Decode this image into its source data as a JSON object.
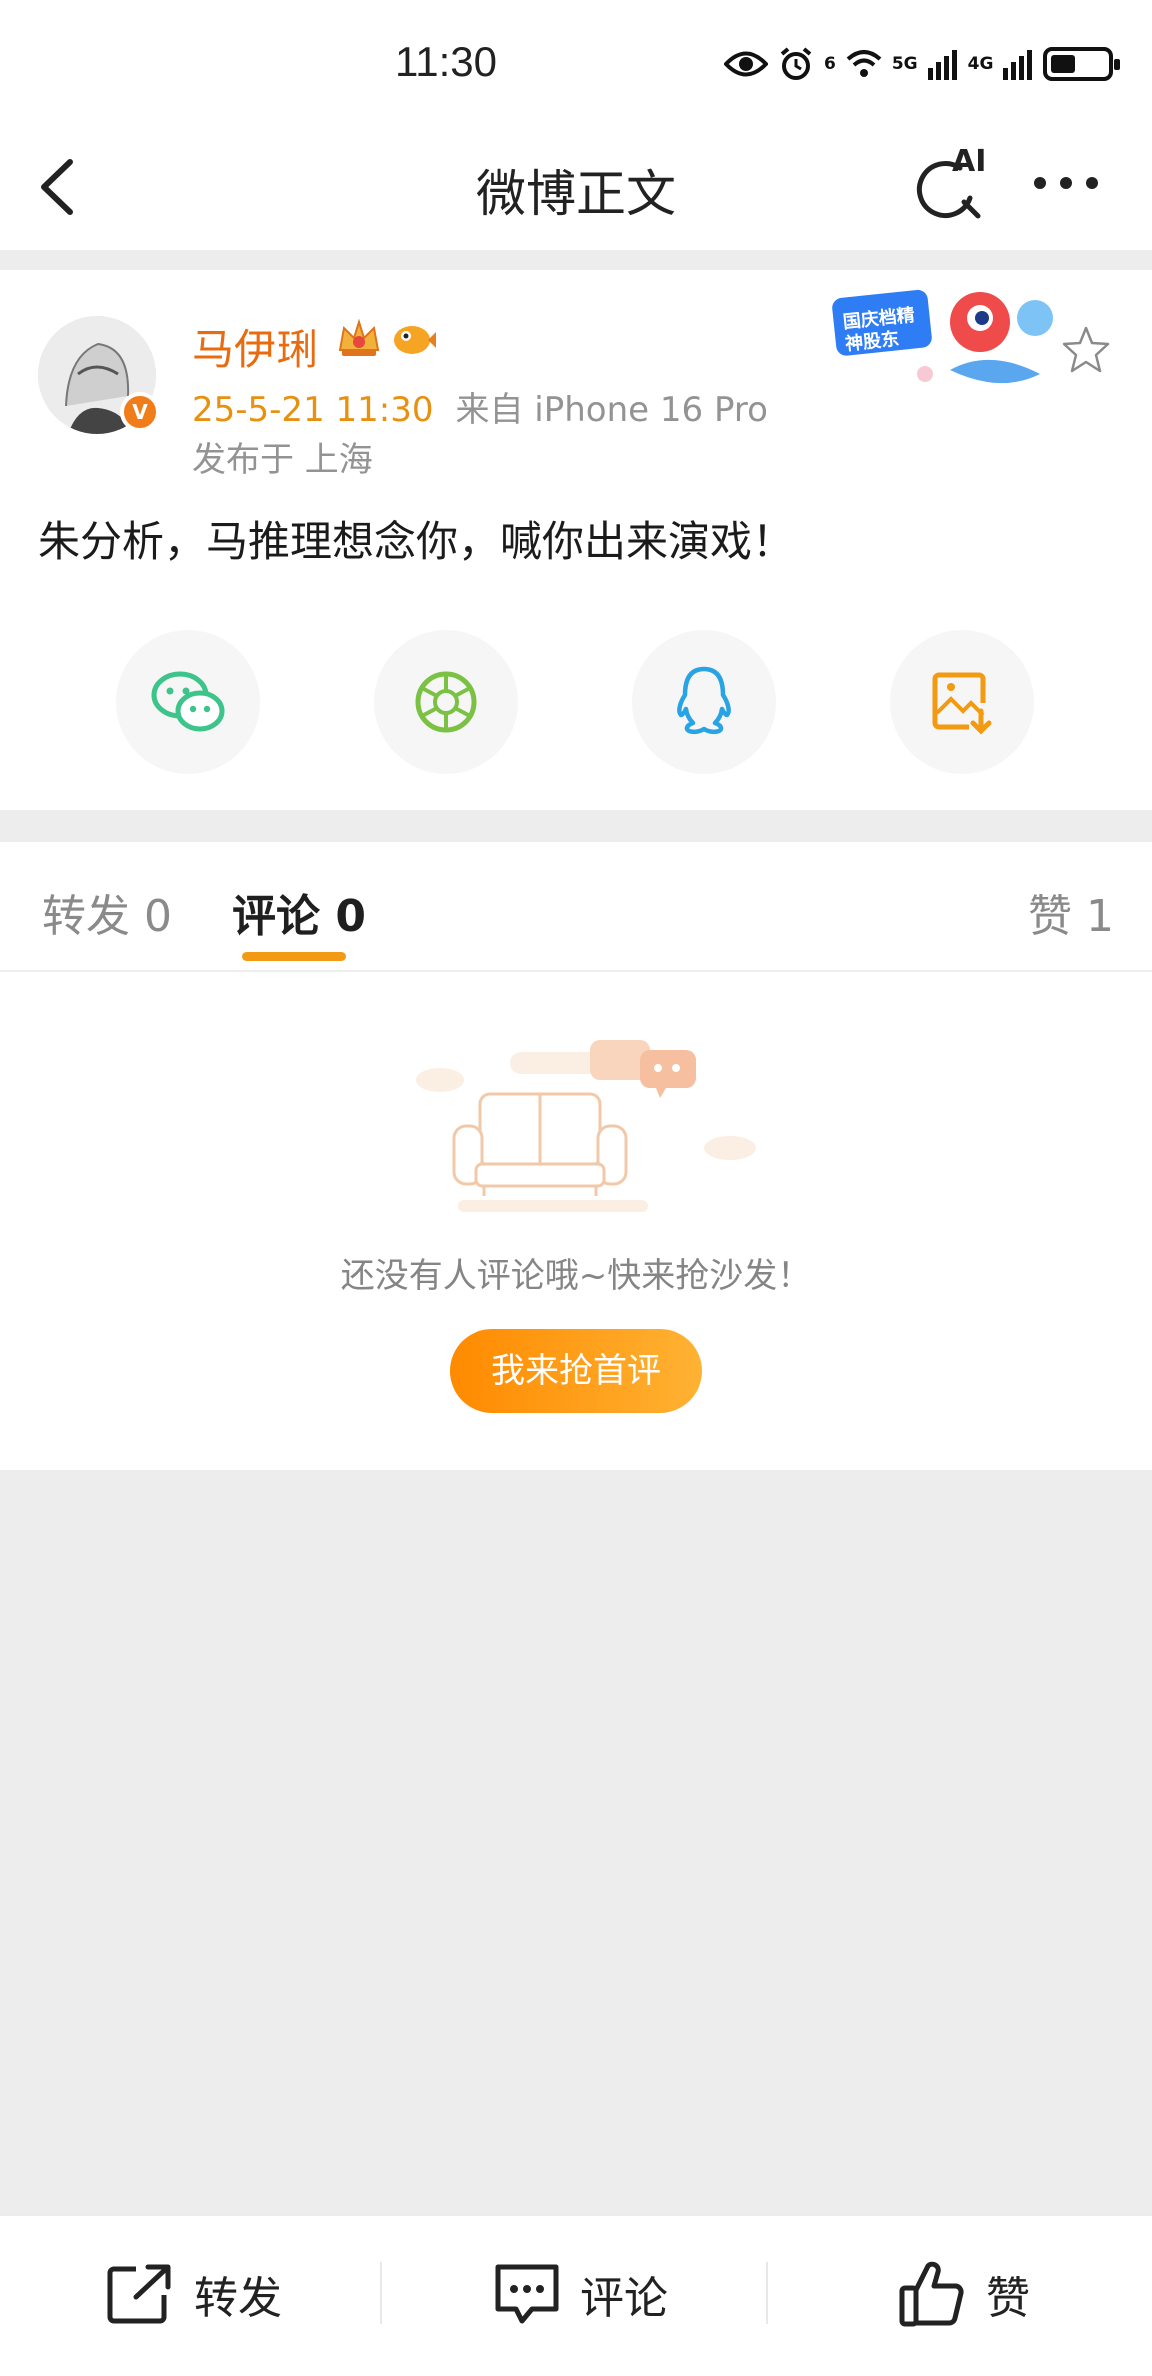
{
  "status_bar": {
    "time": "11:30",
    "sim1_label": "5G",
    "sim2_label": "4G",
    "wifi_label": "6"
  },
  "nav": {
    "title": "微博正文",
    "ai_label": "AI"
  },
  "post": {
    "username": "马伊琍",
    "date": "25-5-21 11:30",
    "source": "来自 iPhone 16 Pro",
    "location": "发布于 上海",
    "text": "朱分析，马推理想念你，喊你出来演戏！",
    "verified_mark": "V",
    "promo_text": "国庆档精神股东",
    "share_icons": [
      "wechat-icon",
      "moments-icon",
      "qq-icon",
      "save-image-icon"
    ]
  },
  "tabs": {
    "repost": "转发 0",
    "comment": "评论 0",
    "like": "赞 1"
  },
  "empty_state": {
    "message": "还没有人评论哦~快来抢沙发！",
    "cta": "我来抢首评"
  },
  "bottom_bar": {
    "repost": "转发",
    "comment": "评论",
    "like": "赞"
  },
  "colors": {
    "accent": "#f39a15",
    "username": "#e86b0f",
    "date": "#e8900f",
    "muted": "#939393",
    "background": "#ededed"
  }
}
